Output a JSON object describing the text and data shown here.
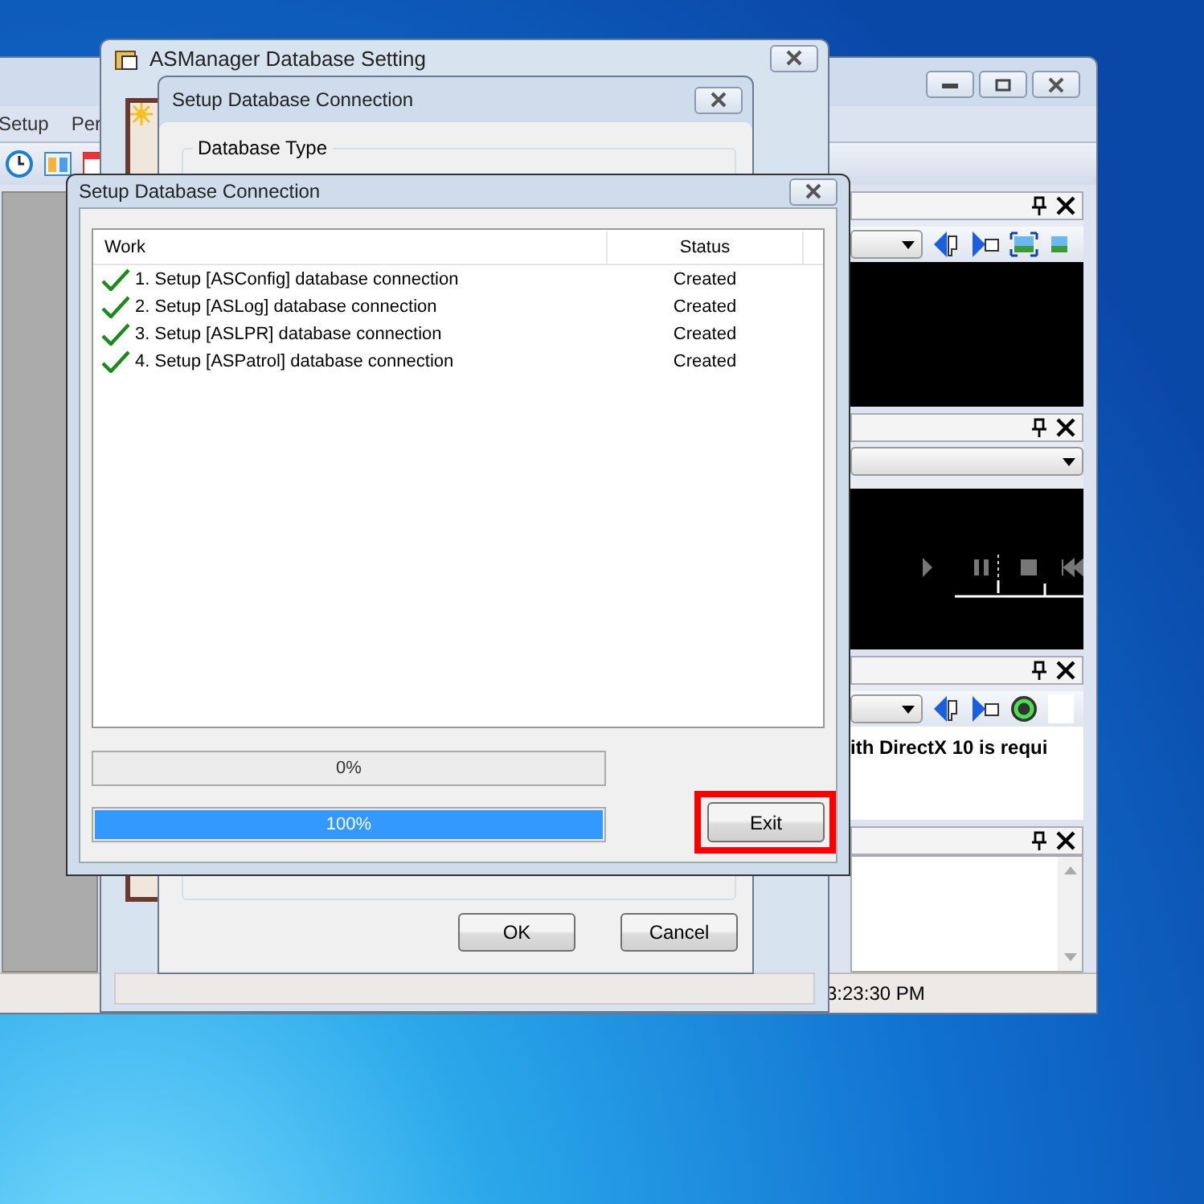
{
  "main_window": {
    "menu": [
      "Setup",
      "Per"
    ],
    "panels": [
      {
        "kind": "video"
      },
      {
        "kind": "player"
      },
      {
        "kind": "message",
        "text": "ith DirectX 10 is requi"
      },
      {
        "kind": "log"
      }
    ],
    "status_time": "3:23:30 PM"
  },
  "settings_window": {
    "title": "ASManager Database Setting"
  },
  "connection_window": {
    "title": "Setup Database Connection",
    "group_label": "Database Type",
    "buttons": [
      "OK",
      "Cancel"
    ]
  },
  "dialog": {
    "title": "Setup Database Connection",
    "columns": [
      "Work",
      "Status"
    ],
    "rows": [
      {
        "work": "1. Setup [ASConfig] database connection",
        "status": "Created",
        "done": true
      },
      {
        "work": "2. Setup [ASLog] database connection",
        "status": "Created",
        "done": true
      },
      {
        "work": "3. Setup [ASLPR] database connection",
        "status": "Created",
        "done": true
      },
      {
        "work": "4. Setup [ASPatrol] database connection",
        "status": "Created",
        "done": true
      }
    ],
    "progress": [
      {
        "label": "0%",
        "level": 0
      },
      {
        "label": "100%",
        "level": 1
      }
    ],
    "exit_button": {
      "label": "Exit",
      "highlighted": true
    }
  }
}
